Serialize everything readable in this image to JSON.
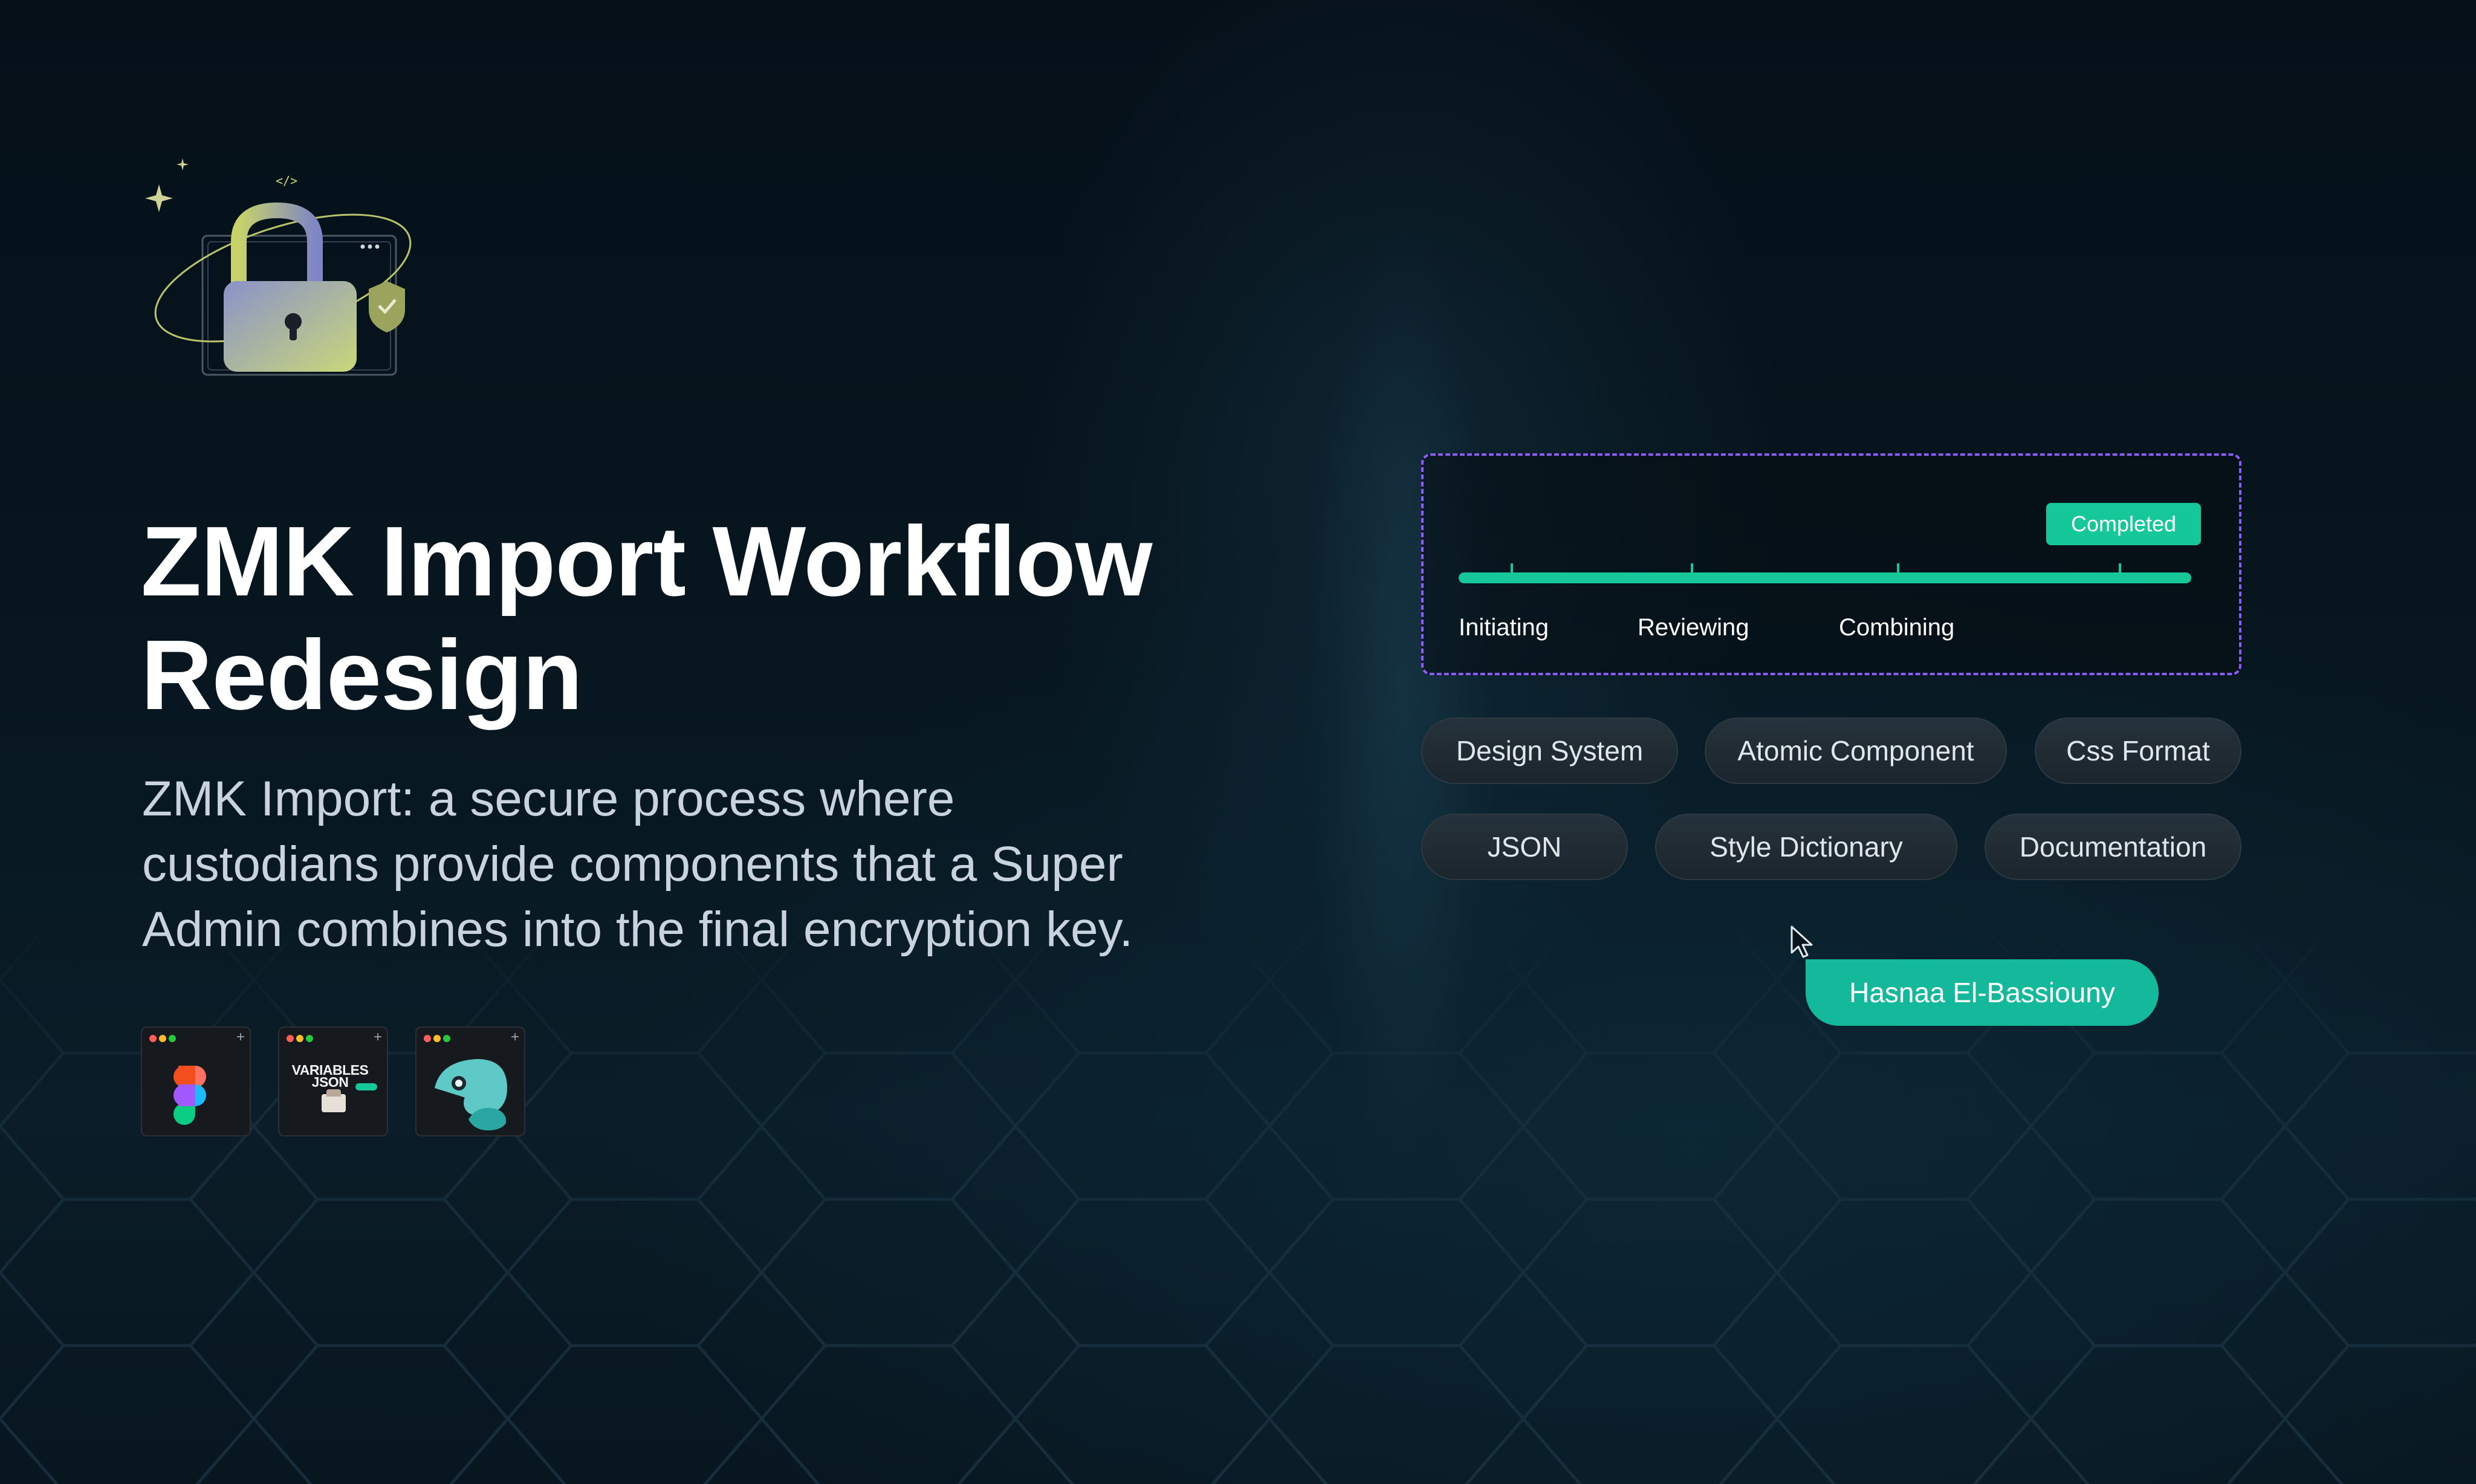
{
  "page": {
    "title_lines": [
      "ZMK Import Workflow",
      "Redesign"
    ],
    "description_lines": [
      "ZMK Import: a secure process where",
      "custodians provide components that a Super",
      "Admin combines into the final encryption key."
    ],
    "hero_icon": "padlock-shield-icon",
    "hero_code_glyph": "</>"
  },
  "tools": [
    {
      "name": "figma",
      "icon": "figma-icon"
    },
    {
      "name": "variables-json",
      "icon": "variables-json-icon",
      "text": "VARIABLES JSON"
    },
    {
      "name": "style-dictionary",
      "icon": "chameleon-icon"
    }
  ],
  "progress": {
    "badge": "Completed",
    "steps": [
      "Initiating",
      "Reviewing",
      "Combining"
    ],
    "fill_fraction": 1.0
  },
  "chips": {
    "row1": [
      "Design System",
      "Atomic Component",
      "Css Format"
    ],
    "row2": [
      "JSON",
      "Style Dictionary",
      "Documentation"
    ]
  },
  "cursor": {
    "name": "Hasnaa El-Bassiouny"
  },
  "colors": {
    "background": "#07121b",
    "accent": "#16c79a",
    "dashed_border": "#8b5cf6",
    "name_tag": "#14b89a"
  }
}
